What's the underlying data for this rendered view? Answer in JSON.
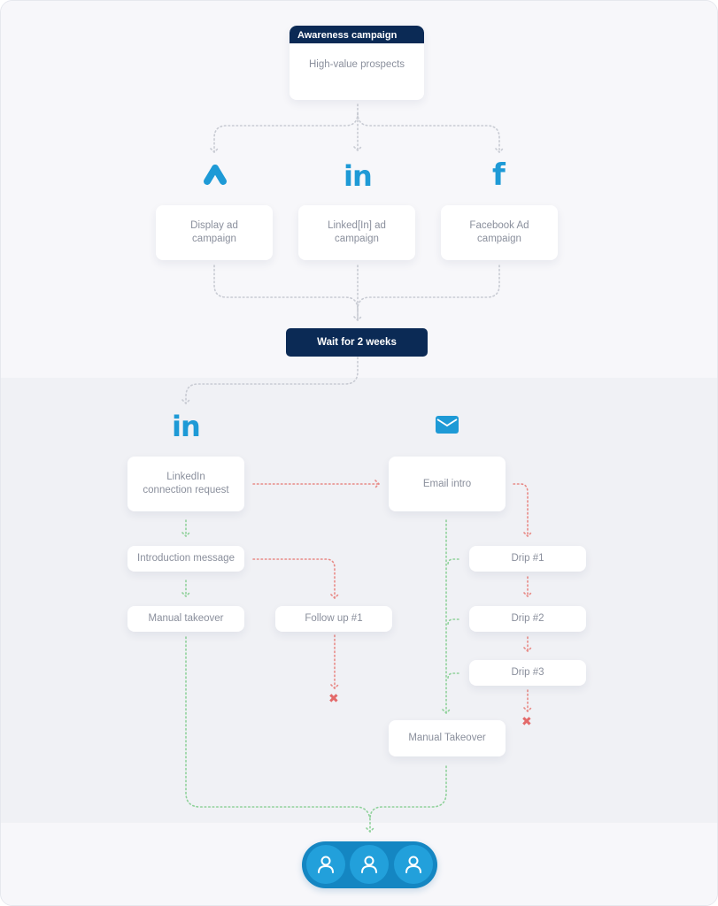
{
  "colors": {
    "navy": "#0b2a55",
    "brand_blue": "#1e9ad6",
    "success_green": "#8fd19a",
    "fail_red": "#e88a86",
    "neutral_connector": "#c5c8d0",
    "node_text": "#8a8f9c"
  },
  "start": {
    "header": "Awareness campaign",
    "label": "High-value prospects"
  },
  "channels": [
    {
      "icon": "google-ads-icon",
      "label": "Display ad campaign",
      "line1": "Display ad",
      "line2": "campaign"
    },
    {
      "icon": "linkedin-icon",
      "label": "Linked[In] ad campaign",
      "line1": "Linked[In] ad",
      "line2": "campaign",
      "glyph": "in"
    },
    {
      "icon": "facebook-icon",
      "label": "Facebook Ad campaign",
      "line1": "Facebook Ad",
      "line2": "campaign",
      "glyph": "f"
    }
  ],
  "wait": {
    "label": "Wait for 2 weeks"
  },
  "linkedin_track": {
    "icon": "linkedin-icon",
    "glyph": "in",
    "connection_request": {
      "line1": "LinkedIn",
      "line2": "connection request"
    },
    "intro_message": "Introduction message",
    "manual_takeover": "Manual takeover",
    "follow_up": "Follow up #1",
    "end": "stop"
  },
  "email_track": {
    "icon": "email-icon",
    "email_intro": "Email intro",
    "drips": [
      "Drip #1",
      "Drip #2",
      "Drip #3"
    ],
    "manual_takeover": "Manual Takeover",
    "end": "stop"
  },
  "legend": {
    "stop_glyph": "✖"
  },
  "audience": {
    "icon": "user-icon",
    "count": 3
  }
}
